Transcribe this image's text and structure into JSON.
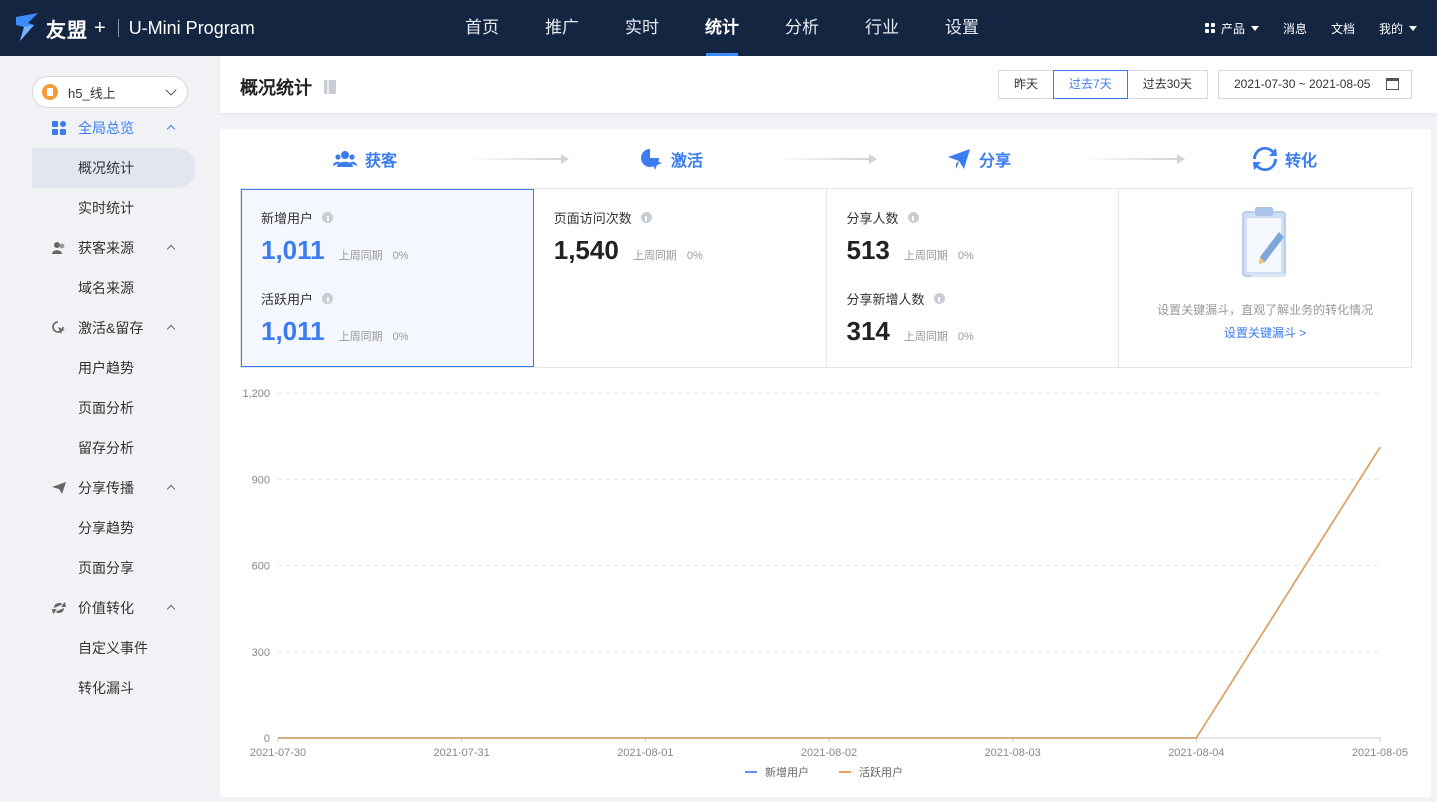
{
  "topbar": {
    "brand": "友盟",
    "plus": "+",
    "product": "U-Mini Program",
    "nav": [
      "首页",
      "推广",
      "实时",
      "统计",
      "分析",
      "行业",
      "设置"
    ],
    "active_nav_index": 3,
    "right": {
      "products": "产品",
      "messages": "消息",
      "docs": "文档",
      "mine": "我的"
    }
  },
  "sidebar": {
    "app_selector": "h5_线上",
    "groups": [
      {
        "label": "全局总览",
        "icon": "dashboard-icon",
        "items": [
          "概况统计",
          "实时统计"
        ]
      },
      {
        "label": "获客来源",
        "icon": "users-icon",
        "items": [
          "域名来源"
        ]
      },
      {
        "label": "激活&留存",
        "icon": "cursor-icon",
        "items": [
          "用户趋势",
          "页面分析",
          "留存分析"
        ]
      },
      {
        "label": "分享传播",
        "icon": "paper-plane-icon",
        "items": [
          "分享趋势",
          "页面分享"
        ]
      },
      {
        "label": "价值转化",
        "icon": "refresh-icon",
        "items": [
          "自定义事件",
          "转化漏斗"
        ]
      }
    ],
    "active_item": "概况统计"
  },
  "header": {
    "title": "概况统计",
    "ranges": [
      "昨天",
      "过去7天",
      "过去30天"
    ],
    "active_range": "过去7天",
    "date_range": "2021-07-30 ~ 2021-08-05"
  },
  "steps": [
    "获客",
    "激活",
    "分享",
    "转化"
  ],
  "cards": {
    "acquire": {
      "new_users": {
        "label": "新增用户",
        "value": "1,011",
        "compare": "上周同期",
        "pct": "0%"
      },
      "active_users": {
        "label": "活跃用户",
        "value": "1,011",
        "compare": "上周同期",
        "pct": "0%"
      }
    },
    "activate": {
      "page_views": {
        "label": "页面访问次数",
        "value": "1,540",
        "compare": "上周同期",
        "pct": "0%"
      }
    },
    "share": {
      "sharers": {
        "label": "分享人数",
        "value": "513",
        "compare": "上周同期",
        "pct": "0%"
      },
      "new_sharers": {
        "label": "分享新增人数",
        "value": "314",
        "compare": "上周同期",
        "pct": "0%"
      }
    },
    "convert": {
      "hint": "设置关键漏斗，直观了解业务的转化情况",
      "link": "设置关键漏斗 >"
    }
  },
  "chart_data": {
    "type": "line",
    "x": [
      "2021-07-30",
      "2021-07-31",
      "2021-08-01",
      "2021-08-02",
      "2021-08-03",
      "2021-08-04",
      "2021-08-05"
    ],
    "series": [
      {
        "name": "新增用户",
        "color": "#5b8ff9",
        "values": [
          0,
          0,
          0,
          0,
          0,
          0,
          1011
        ]
      },
      {
        "name": "活跃用户",
        "color": "#e8a25c",
        "values": [
          0,
          0,
          0,
          0,
          0,
          0,
          1011
        ]
      }
    ],
    "ylim": [
      0,
      1200
    ],
    "yticks": [
      "0",
      "300",
      "600",
      "900",
      "1,200"
    ],
    "ytick_values": [
      0,
      300,
      600,
      900,
      1200
    ],
    "grid": true,
    "legend": "bottom-center"
  }
}
